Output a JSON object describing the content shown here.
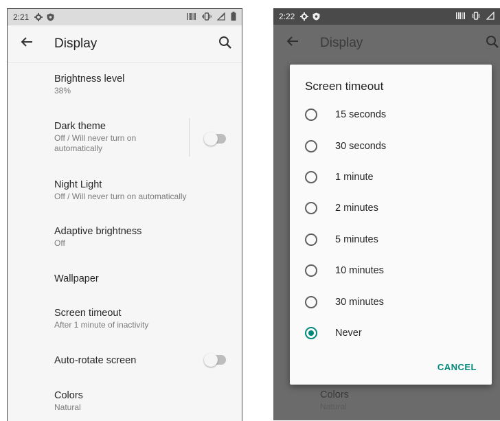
{
  "left": {
    "status": {
      "time": "2:21"
    },
    "title": "Display",
    "items": [
      {
        "title": "Brightness level",
        "subtitle": "38%"
      },
      {
        "title": "Dark theme",
        "subtitle": "Off / Will never turn on automatically",
        "toggle": false
      },
      {
        "title": "Night Light",
        "subtitle": "Off / Will never turn on automatically"
      },
      {
        "title": "Adaptive brightness",
        "subtitle": "Off"
      },
      {
        "title": "Wallpaper"
      },
      {
        "title": "Screen timeout",
        "subtitle": "After 1 minute of inactivity"
      },
      {
        "title": "Auto-rotate screen",
        "toggle": false
      },
      {
        "title": "Colors",
        "subtitle": "Natural"
      }
    ]
  },
  "right": {
    "status": {
      "time": "2:22"
    },
    "title": "Display",
    "dialog": {
      "title": "Screen timeout",
      "options": [
        "15 seconds",
        "30 seconds",
        "1 minute",
        "2 minutes",
        "5 minutes",
        "10 minutes",
        "30 minutes",
        "Never"
      ],
      "selected": "Never",
      "cancel": "CANCEL"
    },
    "below_dialog": {
      "title": "Colors",
      "subtitle": "Natural"
    }
  },
  "colors": {
    "accent": "#00897b"
  }
}
